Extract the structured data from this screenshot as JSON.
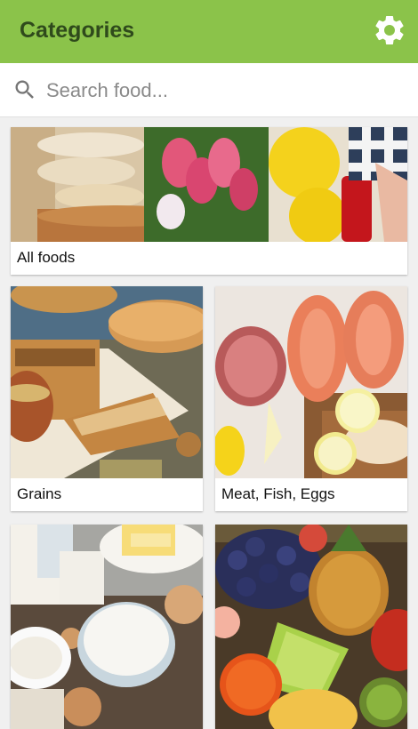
{
  "app_bar": {
    "title": "Categories",
    "settings_icon": "gear-icon",
    "background": "#8bc34a"
  },
  "search": {
    "placeholder": "Search food...",
    "value": "",
    "icon": "search-icon"
  },
  "categories": [
    {
      "label": "All foods"
    },
    {
      "label": "Grains"
    },
    {
      "label": "Meat, Fish, Eggs"
    }
  ]
}
